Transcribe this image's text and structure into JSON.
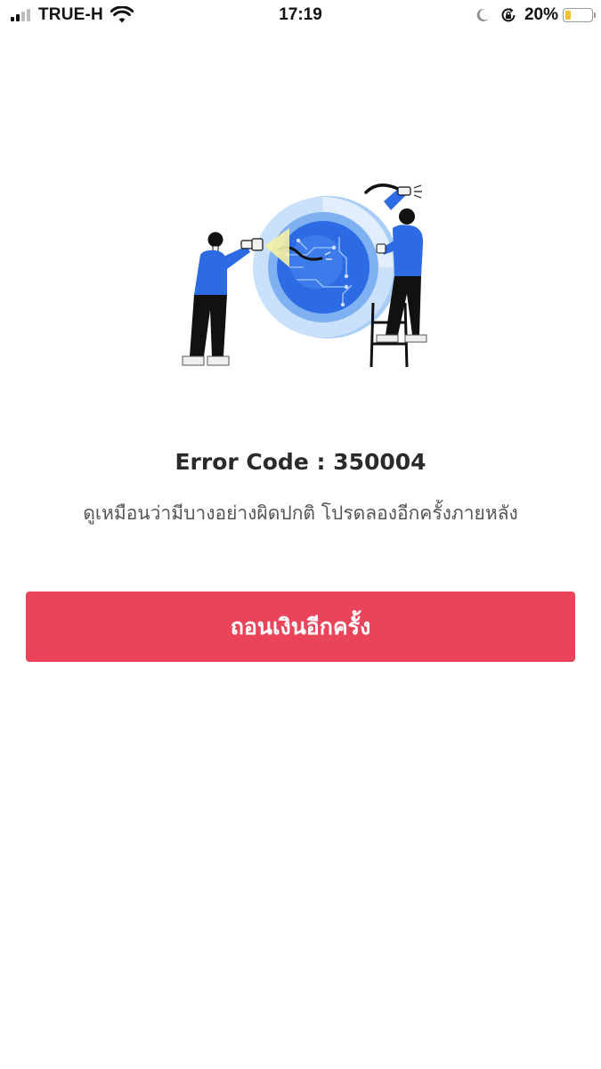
{
  "status_bar": {
    "carrier": "TRUE-H",
    "time": "17:19",
    "battery_percent": "20%",
    "battery_level": 0.2,
    "icons": [
      "signal-icon",
      "wifi-icon",
      "moon-icon",
      "rotation-lock-icon",
      "battery-icon"
    ]
  },
  "error": {
    "code_text": "Error Code : 350004",
    "message": "ดูเหมือนว่ามีบางอย่างผิดปกติ โปรดลองอีกครั้งภายหลัง"
  },
  "retry_button": {
    "label": "ถอนเงินอีกครั้ง"
  },
  "colors": {
    "accent": "#e9445a",
    "background": "#ffffff",
    "illustration_blue": "#2d6be4",
    "battery_fill": "#f2c12e"
  }
}
